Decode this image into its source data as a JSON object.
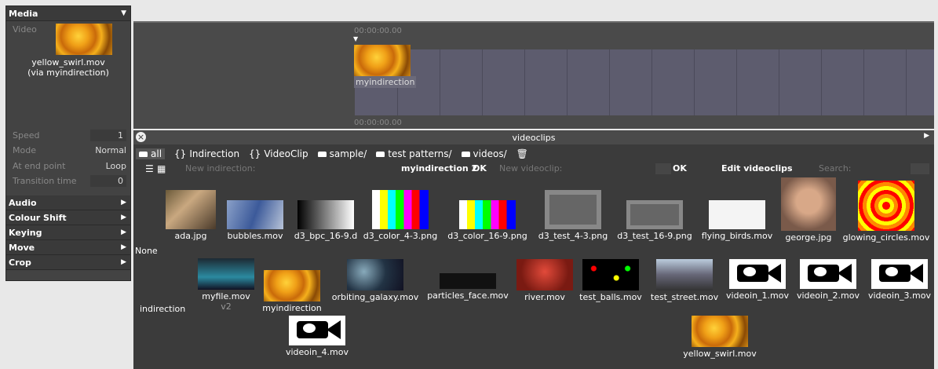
{
  "colors": {
    "panel": "#434343",
    "timeline_track": "#5d5c6e",
    "browser_bg": "#3b3b3b"
  },
  "properties": {
    "sections": {
      "media": "Media",
      "audio": "Audio",
      "colour_shift": "Colour Shift",
      "keying": "Keying",
      "move": "Move",
      "crop": "Crop"
    },
    "video_label": "Video",
    "video_name": "yellow_swirl.mov",
    "video_via": "(via myindirection)",
    "rows": [
      {
        "label": "Speed",
        "value": "1"
      },
      {
        "label": "Mode",
        "value": "Normal"
      },
      {
        "label": "At end point",
        "value": "Loop"
      },
      {
        "label": "Transition time",
        "value": "0"
      }
    ]
  },
  "timeline": {
    "top_timecode": "00:00:00.00",
    "bottom_timecode": "00:00:00.00",
    "clip_label": "myindirection"
  },
  "browser": {
    "title": "videoclips",
    "filters": {
      "all": "all",
      "indirection": "Indirection",
      "videoclip": "VideoClip",
      "sample": "sample/",
      "test_patterns": "test patterns/",
      "videos": "videos/"
    },
    "new_indirection_label": "New indirection:",
    "new_indirection_value": "myindirection 2",
    "ok1": "OK",
    "new_videoclip_label": "New videoclip:",
    "ok2": "OK",
    "edit_videoclips": "Edit videoclips",
    "search_label": "Search:",
    "group_none": "None",
    "group_indirection": "indirection",
    "row1": [
      "ada.jpg",
      "bubbles.mov",
      "d3_bpc_16-9.d",
      "d3_color_4-3.png",
      "d3_color_16-9.png",
      "d3_test_4-3.png",
      "d3_test_16-9.png",
      "flying_birds.mov",
      "george.jpg",
      "glowing_circles.mov"
    ],
    "row2": [
      "myfile.mov",
      "myindirection",
      "orbiting_galaxy.mov",
      "particles_face.mov",
      "river.mov",
      "test_balls.mov",
      "test_street.mov",
      "videoin_1.mov",
      "videoin_2.mov",
      "videoin_3.mov"
    ],
    "myfile_sub": "v2",
    "row3": [
      "videoin_4.mov",
      "yellow_swirl.mov"
    ]
  }
}
